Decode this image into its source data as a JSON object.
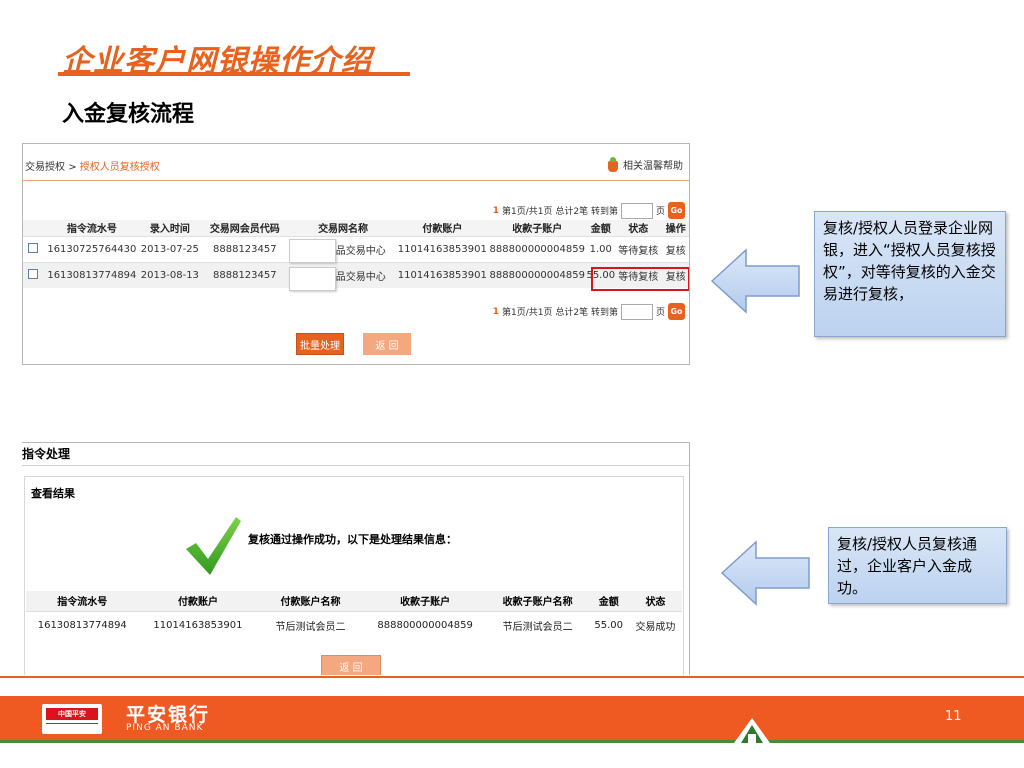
{
  "slide": {
    "title": "企业客户网银操作介绍",
    "section": "入金复核流程",
    "page_number": "11"
  },
  "screen1": {
    "breadcrumb_parent": "交易授权",
    "breadcrumb_sep": ">",
    "breadcrumb_current": "授权人员复核授权",
    "help_label": "相关温馨帮助",
    "pager": {
      "page": "1",
      "text": "第1页/共1页 总计2笔 转到第",
      "suffix": "页",
      "go": "Go"
    },
    "columns": [
      "",
      "指令流水号",
      "录入时间",
      "交易网会员代码",
      "交易网名称",
      "付款账户",
      "收款子账户",
      "金额",
      "状态",
      "操作"
    ],
    "rows": [
      {
        "serial": "16130725764430",
        "date": "2013-07-25",
        "member_code": "8888123457",
        "exchange_name": "商品交易中心",
        "pay_account": "11014163853901",
        "sub_account": "888800000004859",
        "amount": "1.00",
        "status": "等待复核",
        "action": "复核"
      },
      {
        "serial": "16130813774894",
        "date": "2013-08-13",
        "member_code": "8888123457",
        "exchange_name": "商品交易中心",
        "pay_account": "11014163853901",
        "sub_account": "888800000004859",
        "amount": "55.00",
        "status": "等待复核",
        "action": "复核"
      }
    ],
    "batch_button": "批量处理",
    "back_button": "返 回"
  },
  "screen2": {
    "header": "指令处理",
    "subheader": "查看结果",
    "success_message": "复核通过操作成功，以下是处理结果信息：",
    "columns": [
      "指令流水号",
      "付款账户",
      "付款账户名称",
      "收款子账户",
      "收款子账户名称",
      "金额",
      "状态"
    ],
    "row": {
      "serial": "16130813774894",
      "pay_account": "11014163853901",
      "pay_name": "节后测试会员二",
      "sub_account": "888800000004859",
      "sub_name": "节后测试会员二",
      "amount": "55.00",
      "status": "交易成功"
    },
    "back_button": "返 回"
  },
  "callouts": {
    "first": "复核/授权人员登录企业网银，进入“授权人员复核授权”，对等待复核的入金交易进行复核，",
    "second": "复核/授权人员复核通过，企业客户入金成功。"
  },
  "footer": {
    "logo_text": "中国平安",
    "brand_cn": "平安银行",
    "brand_en": "PING AN BANK"
  },
  "colors": {
    "accent": "#e8621f",
    "highlight": "#d8141c",
    "callout": "#c9daf2"
  }
}
